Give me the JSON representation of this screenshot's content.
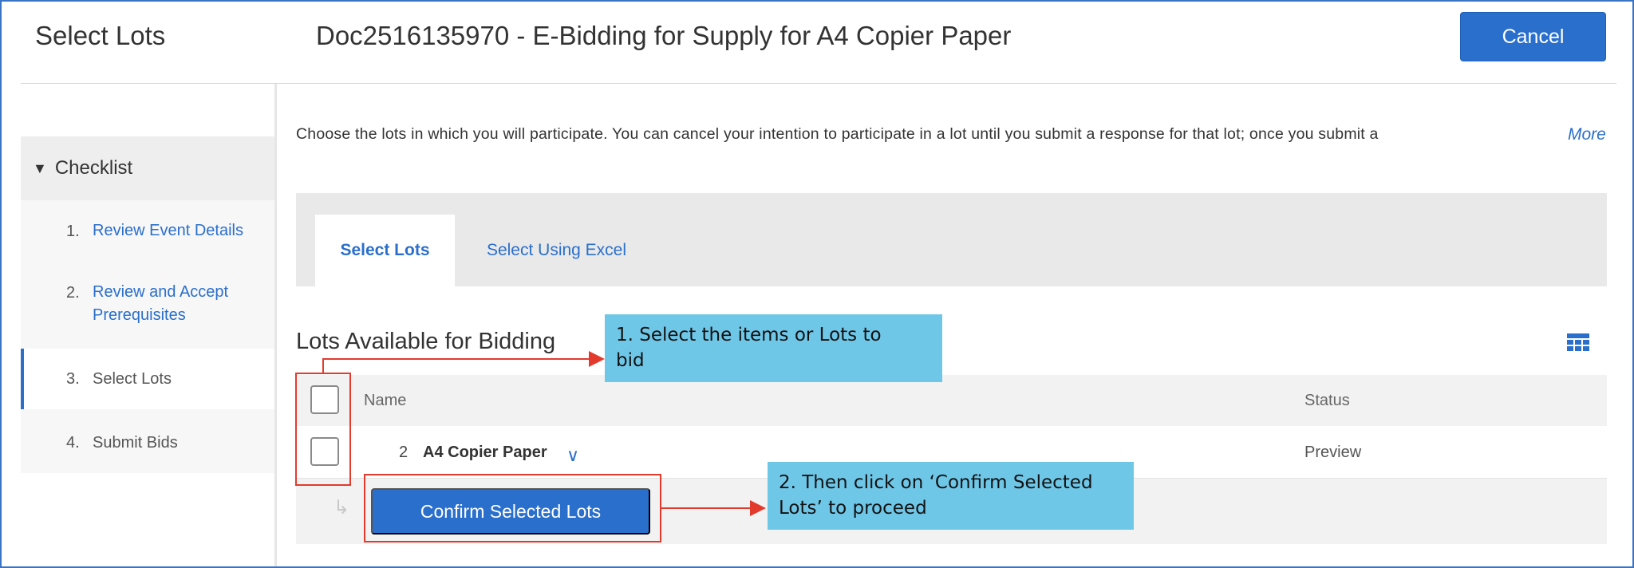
{
  "header": {
    "title": "Select Lots",
    "doc_title": "Doc2516135970 - E-Bidding for Supply for A4 Copier Paper",
    "cancel_label": "Cancel"
  },
  "sidebar": {
    "checklist_label": "Checklist",
    "steps": [
      {
        "num": "1.",
        "label": "Review Event Details"
      },
      {
        "num": "2.",
        "label_line1": "Review and Accept",
        "label_line2": "Prerequisites"
      },
      {
        "num": "3.",
        "label": "Select Lots"
      },
      {
        "num": "4.",
        "label": "Submit Bids"
      }
    ]
  },
  "main": {
    "description": "Choose the lots in which you will participate.  You can cancel your intention to participate in a lot until you submit a response for that lot;  once you submit a",
    "more_label": "More",
    "tabs": [
      {
        "label": "Select Lots"
      },
      {
        "label": "Select Using Excel"
      }
    ],
    "lots_title": "Lots Available for Bidding",
    "table": {
      "columns": [
        "Name",
        "Status"
      ],
      "rows": [
        {
          "num": "2",
          "name": "A4 Copier Paper",
          "status": "Preview"
        }
      ]
    },
    "confirm_label": "Confirm Selected Lots"
  },
  "annotations": {
    "callout1_line1": "1. Select the items or Lots to",
    "callout1_line2": "bid",
    "callout2_line1": "2. Then click on ‘Confirm Selected",
    "callout2_line2": "Lots’ to proceed"
  },
  "colors": {
    "accent": "#2a6fcc",
    "callout": "#6fc7e8",
    "annotation_red": "#e23b2e"
  }
}
